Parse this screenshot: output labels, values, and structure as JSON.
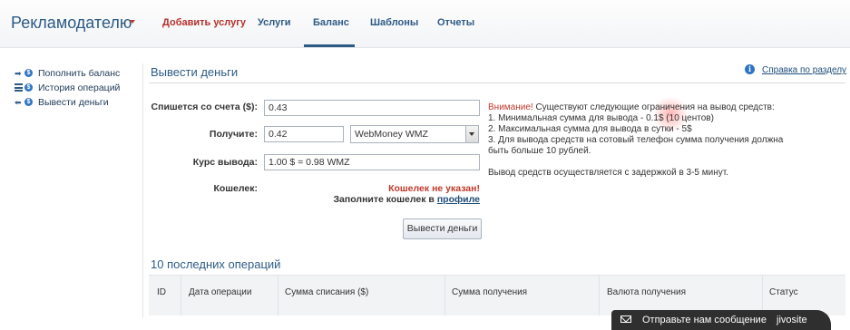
{
  "header": {
    "brand": "Рекламодателю",
    "nav": [
      "Добавить услугу",
      "Услуги",
      "Баланс",
      "Шаблоны",
      "Отчеты"
    ],
    "active_tab": "Баланс"
  },
  "sidebar": {
    "items": [
      {
        "label": "Пополнить баланс",
        "icon": "arrow-right-coin-icon"
      },
      {
        "label": "История операций",
        "icon": "list-coin-icon"
      },
      {
        "label": "Вывести деньги",
        "icon": "arrow-left-coin-icon"
      }
    ]
  },
  "main": {
    "title": "Вывести деньги",
    "help_link": "Справка по разделу",
    "form": {
      "debit_label": "Спишется со счета ($):",
      "debit_value": "0.43",
      "receive_label": "Получите:",
      "receive_value": "0.42",
      "currency_selected": "WebMoney WMZ",
      "rate_label": "Курс вывода:",
      "rate_value": "1.00 $ = 0.98 WMZ",
      "wallet_label": "Кошелек:",
      "wallet_error": "Кошелек не указан!",
      "wallet_hint": "Заполните кошелек в",
      "wallet_link": "профиле",
      "submit": "Вывести деньги"
    },
    "notice": {
      "warn": "Внимание!",
      "intro": " Существуют следующие ограничения на вывод средств:",
      "line1": "1. Минимальная сумма для вывода - 0.1$ (10 центов)",
      "line2": "2. Максимальная сумма для вывода в сутки - 5$",
      "line3": "3. Для вывода средств на сотовый телефон сумма получения должна быть больше 10 рублей.",
      "delay": "Вывод средств осуществляется с задержкой в 3-5 минут."
    },
    "operations": {
      "title": "10 последних операций",
      "columns": [
        "ID",
        "Дата операции",
        "Сумма списания ($)",
        "Сумма получения",
        "Валюта получения",
        "Статус"
      ]
    }
  },
  "chat": {
    "message": "Отправьте нам сообщение",
    "brand": "jivosite"
  },
  "colors": {
    "accent": "#2d5b86",
    "warning": "#c0392b"
  }
}
